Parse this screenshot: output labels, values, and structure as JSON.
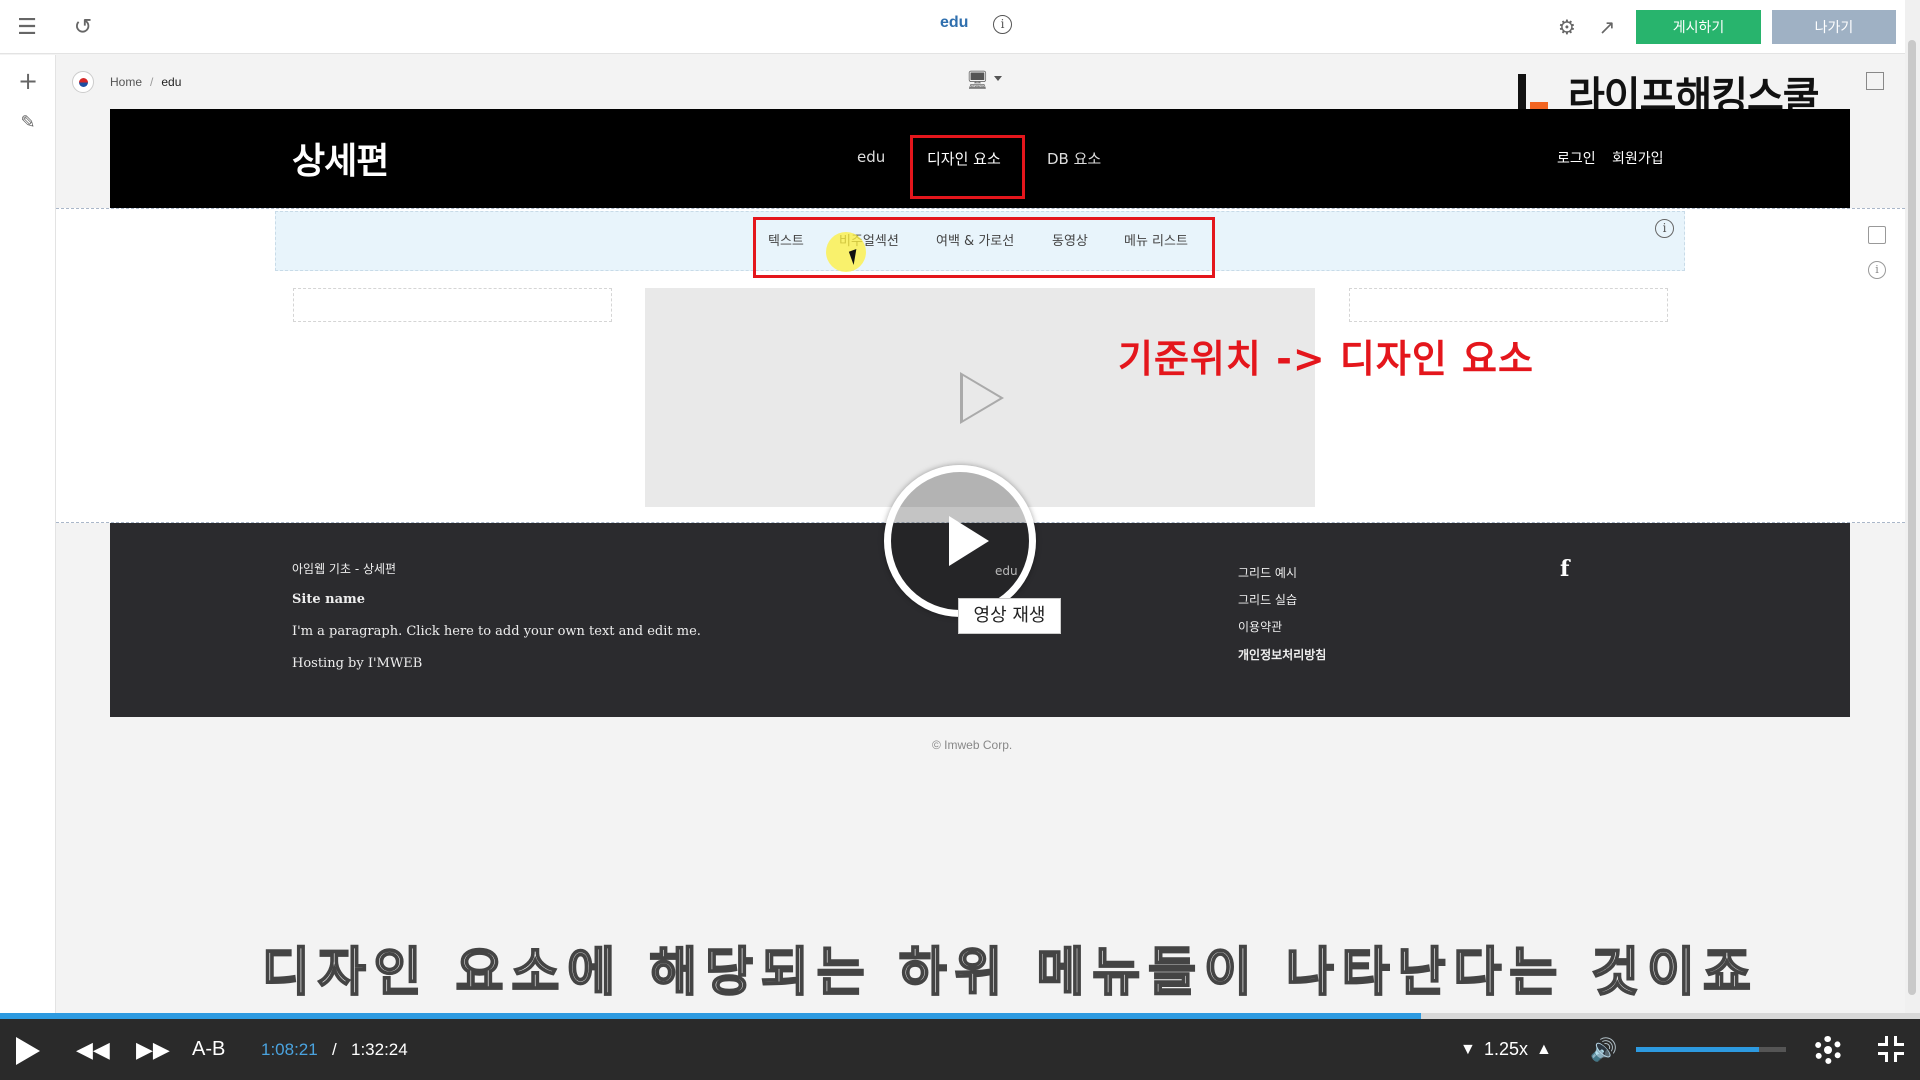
{
  "topbar": {
    "title": "edu",
    "info_icon": "info-icon",
    "publish_label": "게시하기",
    "exit_label": "나가기"
  },
  "breadcrumb": {
    "home": "Home",
    "separator": "/",
    "current": "edu"
  },
  "watermark": "라이프해킹스쿨",
  "site": {
    "logo": "상세편",
    "nav": [
      "edu",
      "디자인 요소",
      "DB 요소"
    ],
    "member": {
      "login": "로그인",
      "signup": "회원가입"
    },
    "submenu": [
      "텍스트",
      "비주얼섹션",
      "여백 & 가로선",
      "동영상",
      "메뉴 리스트"
    ],
    "annotation": "기준위치 -> 디자인 요소",
    "footer": {
      "title": "아임웹 기초 - 상세편",
      "site_name": "Site name",
      "paragraph": "I'm a paragraph. Click here to add your own text and edit me.",
      "hosting": "Hosting by I'MWEB",
      "middle_links": [
        "edu"
      ],
      "links": [
        "그리드 예시",
        "그리드 실습",
        "이용약관",
        "개인정보처리방침"
      ],
      "social_icon": "facebook-icon",
      "copyright": "© Imweb Corp."
    }
  },
  "video_overlay": {
    "tooltip": "영상 재생"
  },
  "subtitle": "디자인 요소에 해당되는 하위 메뉴들이 나타난다는 것이죠",
  "player": {
    "ab_label": "A-B",
    "time_current": "1:08:21",
    "time_separator": "/",
    "time_total": "1:32:24",
    "speed": "1.25x",
    "progress": 0.74,
    "volume": 0.82
  },
  "colors": {
    "publish": "#28b46d",
    "exit": "#9fb1c4",
    "highlight": "#e4161c",
    "progress": "#2d9ae0"
  }
}
